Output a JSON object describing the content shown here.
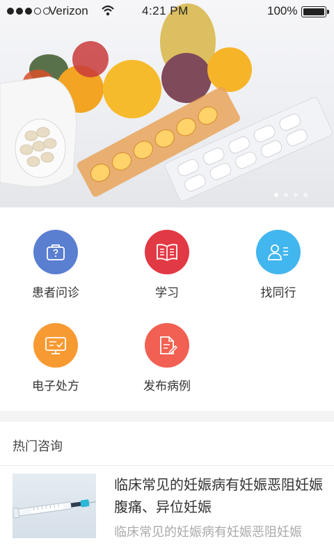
{
  "status_bar": {
    "carrier": "Verizon",
    "time": "4:21 PM",
    "battery": "100%"
  },
  "banner": {
    "image": "fruits-and-medicine-photo",
    "pages": 4,
    "active_page": 0
  },
  "features": [
    {
      "label": "患者问诊",
      "icon": "briefcase-question-icon",
      "color": "#5a7fd1"
    },
    {
      "label": "学习",
      "icon": "open-book-icon",
      "color": "#e23a45"
    },
    {
      "label": "找同行",
      "icon": "doctor-id-icon",
      "color": "#42b6ee"
    },
    {
      "label": "电子处方",
      "icon": "monitor-prescription-icon",
      "color": "#f89a32"
    },
    {
      "label": "发布病例",
      "icon": "document-pen-icon",
      "color": "#f16052"
    }
  ],
  "hot": {
    "title": "热门咨询",
    "articles": [
      {
        "title": "临床常见的妊娠病有妊娠恶阻妊娠腹痛、异位妊娠",
        "summary": "临床常见的妊娠病有妊娠恶阻妊娠",
        "thumbnail": "syringe-photo"
      }
    ]
  }
}
